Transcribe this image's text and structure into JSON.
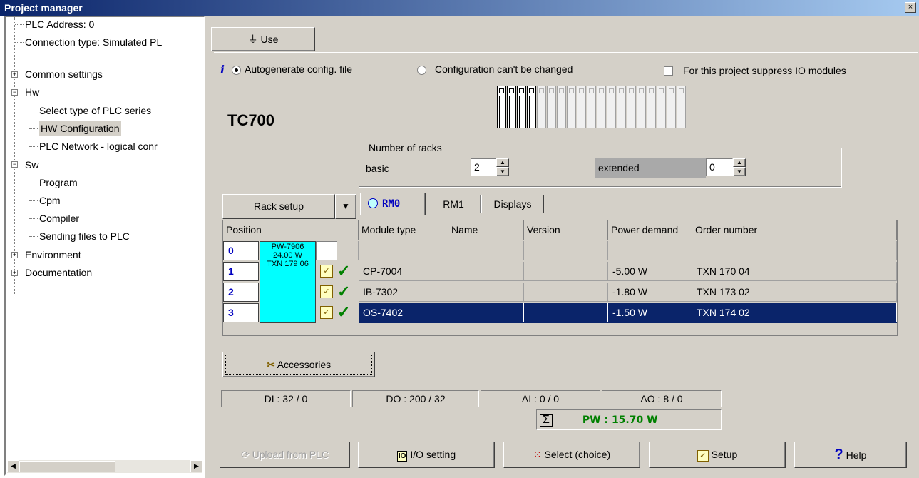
{
  "window": {
    "title": "Project manager",
    "close": "×"
  },
  "tree": {
    "items": [
      {
        "label": "PLC Address: 0",
        "exp": ""
      },
      {
        "label": "Connection type: Simulated PL",
        "exp": ""
      },
      {
        "label": "Common settings",
        "exp": "+"
      },
      {
        "label": "Hw",
        "exp": "−"
      },
      {
        "label": "Select type of PLC series",
        "exp": ""
      },
      {
        "label": "HW Configuration",
        "exp": ""
      },
      {
        "label": "PLC Network - logical conr",
        "exp": ""
      },
      {
        "label": "Sw",
        "exp": "−"
      },
      {
        "label": "Program",
        "exp": ""
      },
      {
        "label": "Cpm",
        "exp": ""
      },
      {
        "label": "Compiler",
        "exp": ""
      },
      {
        "label": "Sending files to PLC",
        "exp": ""
      },
      {
        "label": "Environment",
        "exp": "+"
      },
      {
        "label": "Documentation",
        "exp": "+"
      }
    ]
  },
  "toolbar": {
    "use_label": "Use",
    "use_underline": "U"
  },
  "options": {
    "info": "i",
    "autogen": "Autogenerate config. file",
    "autogen_underline": "A",
    "cantchange": "Configuration can't be changed",
    "suppress": "For this project suppress IO modules"
  },
  "plc": {
    "name": "TC700"
  },
  "racks": {
    "title": "Number of racks",
    "basic_label": "basic",
    "basic_value": "2",
    "extended_label": "extended",
    "extended_value": "0"
  },
  "rack_setup": {
    "label": "Rack setup"
  },
  "tabs": [
    {
      "label": "RM0"
    },
    {
      "label": "RM1"
    },
    {
      "label": "Displays"
    }
  ],
  "table": {
    "headers": {
      "position": "Position",
      "module": "Module type",
      "name": "Name",
      "version": "Version",
      "power": "Power demand",
      "order": "Order number"
    },
    "ps": {
      "line1": "PW-7906",
      "line2": "24.00 W",
      "line3": "TXN 179 06"
    },
    "rows": [
      {
        "pos": "0",
        "module": "",
        "name": "",
        "version": "",
        "power": "",
        "order": ""
      },
      {
        "pos": "1",
        "module": "CP-7004",
        "name": "",
        "version": "",
        "power": "-5.00 W",
        "order": "TXN 170 04"
      },
      {
        "pos": "2",
        "module": "IB-7302",
        "name": "",
        "version": "",
        "power": "-1.80 W",
        "order": "TXN 173 02"
      },
      {
        "pos": "3",
        "module": "OS-7402",
        "name": "",
        "version": "",
        "power": "-1.50 W",
        "order": "TXN 174 02"
      }
    ]
  },
  "accessories": {
    "label": "Accessories"
  },
  "status": {
    "di": "DI : 32 / 0",
    "do": "DO : 200 / 32",
    "ai": "AI : 0 / 0",
    "ao": "AO : 8 / 0",
    "sigma": "Σ",
    "pw": "PW : 15.70 W"
  },
  "buttons": {
    "upload": "Upload from PLC",
    "io": "I/O setting",
    "select": "Select (choice)",
    "setup": "Setup",
    "help": "Help"
  },
  "colors": {
    "title_start": "#0a246a",
    "title_end": "#a6caf0",
    "selection": "#0a246a",
    "power_supply": "#00ffff",
    "accent_text": "#0000c0",
    "pw_green": "#008000"
  }
}
